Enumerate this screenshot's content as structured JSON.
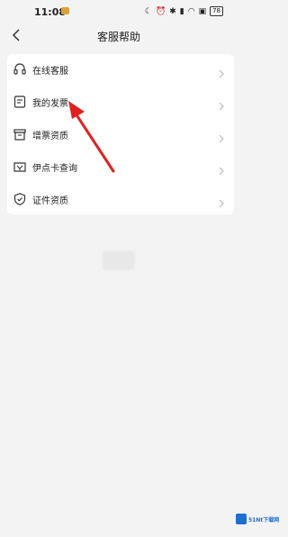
{
  "status_bar": {
    "time": "11:08",
    "battery": "78"
  },
  "header": {
    "title": "客服帮助"
  },
  "menu": {
    "items": [
      {
        "label": "在线客服",
        "icon": "headset-icon"
      },
      {
        "label": "我的发票",
        "icon": "invoice-icon"
      },
      {
        "label": "增票资质",
        "icon": "vat-invoice-icon"
      },
      {
        "label": "伊点卡查询",
        "icon": "card-icon"
      },
      {
        "label": "证件资质",
        "icon": "shield-check-icon"
      }
    ]
  },
  "watermark": {
    "text": "51Nt下载网"
  },
  "colors": {
    "background": "#f3f3f3",
    "card": "#ffffff",
    "annotation": "#e02020"
  }
}
